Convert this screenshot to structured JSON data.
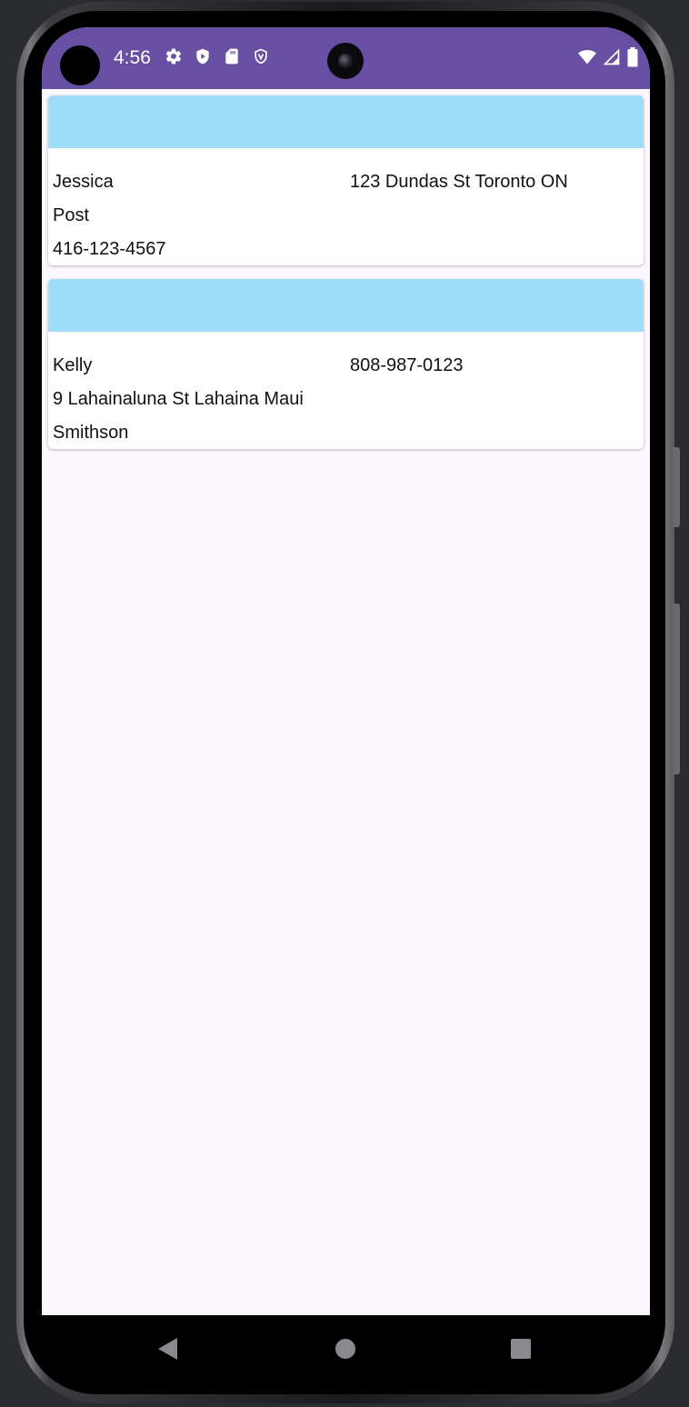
{
  "status_bar": {
    "time": "4:56",
    "color": "#6750a4",
    "left_icons": [
      "settings-icon",
      "play-shield-icon",
      "sd-card-icon",
      "shield-icon"
    ],
    "right_icons": [
      "wifi-icon",
      "signal-icon",
      "battery-icon"
    ]
  },
  "theme": {
    "background": "#fcf6fe",
    "card_header": "#9edcfa",
    "card_background": "#ffffff"
  },
  "contacts": [
    {
      "left_line_1": "Jessica",
      "left_line_2": "Post",
      "left_line_3": "416-123-4567",
      "right_line_1": "123 Dundas St Toronto ON"
    },
    {
      "left_line_1": "Kelly",
      "left_line_2": "9 Lahainaluna St Lahaina Maui",
      "left_line_3": "Smithson",
      "right_line_1": "808-987-0123"
    }
  ],
  "navigation": {
    "buttons": [
      "back-icon",
      "home-icon",
      "recents-icon"
    ]
  }
}
